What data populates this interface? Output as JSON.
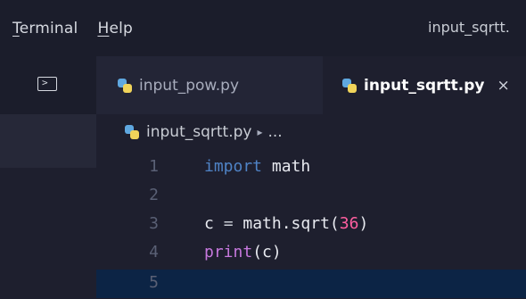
{
  "menu": {
    "items": [
      {
        "label": "Terminal",
        "underline": "T"
      },
      {
        "label": "Help",
        "underline": "H"
      }
    ],
    "window_title": "input_sqrtt."
  },
  "tabs": [
    {
      "label": "input_pow.py",
      "icon": "python-icon",
      "active": false
    },
    {
      "label": "input_sqrtt.py",
      "icon": "python-icon",
      "active": true,
      "close": "×"
    }
  ],
  "breadcrumb": {
    "file": "input_sqrtt.py",
    "separator": "▸",
    "rest": "..."
  },
  "code": {
    "lines": [
      {
        "number": "1",
        "text": "import math"
      },
      {
        "number": "2",
        "text": ""
      },
      {
        "number": "3",
        "text": "c = math.sqrt(36)"
      },
      {
        "number": "4",
        "text": "print(c)"
      },
      {
        "number": "5",
        "text": ""
      }
    ],
    "current_line": "5"
  },
  "colors": {
    "background": "#1e1f2e",
    "current_line": "#0c2445",
    "keyword": "#4f83c6",
    "function": "#c678dd",
    "number": "#ff5fa0"
  }
}
